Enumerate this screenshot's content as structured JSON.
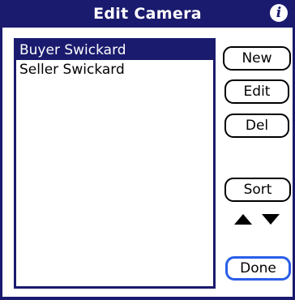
{
  "dialog": {
    "title": "Edit Camera",
    "info_icon": "i"
  },
  "list": {
    "items": [
      {
        "label": "Buyer Swickard",
        "selected": true
      },
      {
        "label": "Seller Swickard",
        "selected": false
      }
    ]
  },
  "buttons": {
    "new_label": "New",
    "edit_label": "Edit",
    "del_label": "Del",
    "sort_label": "Sort",
    "done_label": "Done"
  },
  "icons": {
    "info": "info-icon",
    "move_up": "up-arrow-icon",
    "move_down": "down-arrow-icon"
  },
  "colors": {
    "accent": "#1a1a6e",
    "done_border": "#2a5ee8"
  }
}
